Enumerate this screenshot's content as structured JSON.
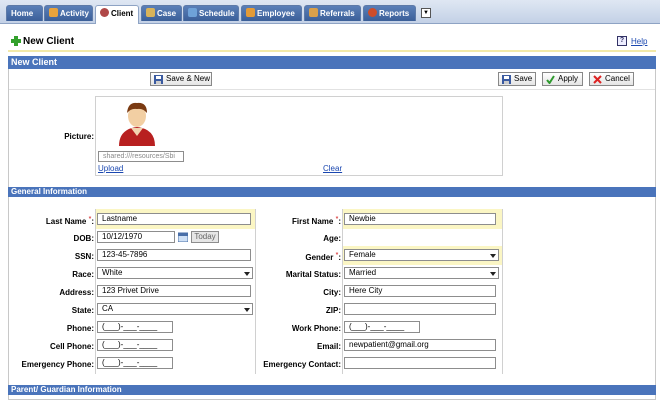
{
  "nav": {
    "tabs": [
      {
        "label": "Home",
        "icon": "home-icon"
      },
      {
        "label": "Activity",
        "icon": "activity-icon"
      },
      {
        "label": "Client",
        "icon": "client-icon"
      },
      {
        "label": "Case",
        "icon": "case-icon"
      },
      {
        "label": "Schedule",
        "icon": "schedule-icon"
      },
      {
        "label": "Employee",
        "icon": "employee-icon"
      },
      {
        "label": "Referrals",
        "icon": "referrals-icon"
      },
      {
        "label": "Reports",
        "icon": "reports-icon"
      }
    ],
    "active_tab": "Client",
    "more_glyph": "▼"
  },
  "header": {
    "title": "New Client",
    "help_icon": "?",
    "help_label": "Help"
  },
  "panel": {
    "title": "New Client"
  },
  "toolbar": {
    "save_new": "Save & New",
    "save": "Save",
    "apply": "Apply",
    "cancel": "Cancel"
  },
  "picture": {
    "label": "Picture:",
    "path": "shared:///resources/Sbi",
    "upload": "Upload",
    "clear": "Clear"
  },
  "sections": {
    "general": "General Information",
    "parent": "Parent/ Guardian Information"
  },
  "left": {
    "last_name": {
      "label": "Last Name",
      "value": "Lastname"
    },
    "dob": {
      "label": "DOB:",
      "value": "10/12/1970",
      "today": "Today"
    },
    "ssn": {
      "label": "SSN:",
      "value": "123-45-7896"
    },
    "race": {
      "label": "Race:",
      "value": "White"
    },
    "address": {
      "label": "Address:",
      "value": "123 Privet Drive"
    },
    "state": {
      "label": "State:",
      "value": "CA"
    },
    "phone": {
      "label": "Phone:",
      "value": "(___)-___-____"
    },
    "cell": {
      "label": "Cell Phone:",
      "value": "(___)-___-____"
    },
    "emergency_phone": {
      "label": "Emergency Phone:",
      "value": "(___)-___-____"
    }
  },
  "right": {
    "first_name": {
      "label": "First Name",
      "value": "Newbie"
    },
    "age": {
      "label": "Age:"
    },
    "gender": {
      "label": "Gender",
      "value": "Female"
    },
    "marital": {
      "label": "Marital Status:",
      "value": "Married"
    },
    "city": {
      "label": "City:",
      "value": "Here City"
    },
    "zip": {
      "label": "ZIP:",
      "value": ""
    },
    "work_phone": {
      "label": "Work Phone:",
      "value": "(___)-___-____"
    },
    "email": {
      "label": "Email:",
      "value": "newpatient@gmail.org"
    },
    "emergency_contact": {
      "label": "Emergency Contact:",
      "value": ""
    }
  },
  "required_mark": "*",
  "colon": ":",
  "colors": {
    "section_bar": "#4a74bb",
    "tab": "#3b5f98",
    "highlight": "#fbf6c4",
    "link": "#1a47b0"
  }
}
